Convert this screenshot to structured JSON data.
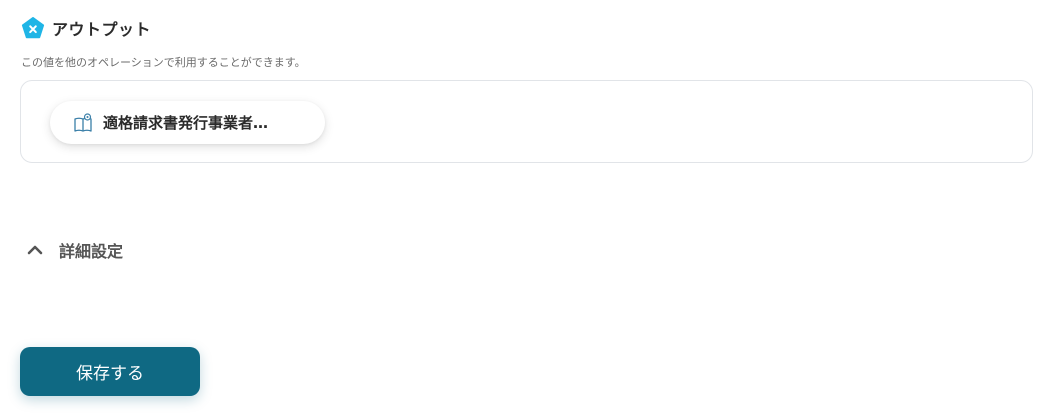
{
  "output_section": {
    "title": "アウトプット",
    "description": "この値を他のオペレーションで利用することができます。",
    "icon": "x-pentagon-icon",
    "icon_color": "#1fb5e6",
    "chips": [
      {
        "label": "適格請求書発行事業者…",
        "icon": "book-icon"
      }
    ]
  },
  "advanced_settings": {
    "label": "詳細設定",
    "icon": "chevron-up-icon",
    "expanded": true
  },
  "actions": {
    "save_label": "保存する",
    "save_color": "#0f6983"
  }
}
